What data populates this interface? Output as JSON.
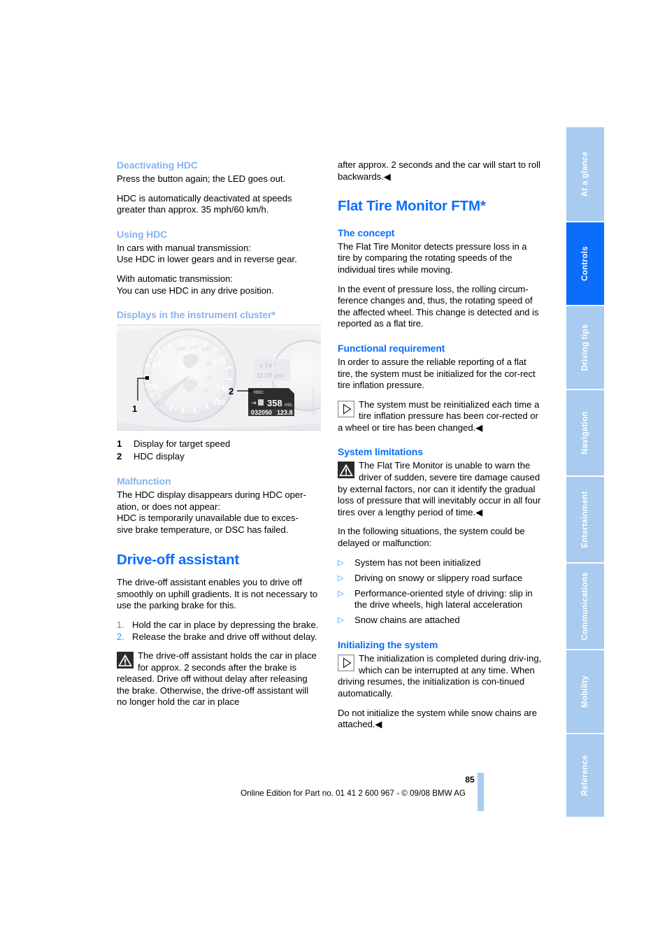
{
  "page": {
    "number": "85",
    "footer": "Online Edition for Part no. 01 41 2 600 967  - © 09/08 BMW AG"
  },
  "colors": {
    "heading_primary": "#0a6efa",
    "heading_secondary": "#85b4ed",
    "tab_inactive": "#a9cbef",
    "tab_active": "#0a6efa",
    "bullet": "#3d8ef5"
  },
  "sidebar": {
    "tabs": [
      {
        "label": "At a glance",
        "active": false
      },
      {
        "label": "Controls",
        "active": true
      },
      {
        "label": "Driving tips",
        "active": false
      },
      {
        "label": "Navigation",
        "active": false
      },
      {
        "label": "Entertainment",
        "active": false
      },
      {
        "label": "Communications",
        "active": false
      },
      {
        "label": "Mobility",
        "active": false
      },
      {
        "label": "Reference",
        "active": false
      }
    ]
  },
  "left_column": {
    "h_deactivating": "Deactivating HDC",
    "p_deactivating_1": "Press the button again; the LED goes out.",
    "p_deactivating_2": "HDC is automatically deactivated at speeds greater than approx. 35 mph/60 km/h.",
    "h_using": "Using HDC",
    "p_using_1": "In cars with manual transmission:\nUse HDC in lower gears and in reverse gear.",
    "p_using_2": "With automatic transmission:\nYou can use HDC in any drive position.",
    "h_displays": "Displays in the instrument cluster*",
    "figure": {
      "callout_1": "1",
      "callout_2": "2",
      "display_hdc_label": "HDC",
      "display_range": "358",
      "display_range_unit": "mls",
      "display_odometer": "032050",
      "display_trip": "123.8",
      "display_temp": "74",
      "display_clock": "11:15 pm",
      "speedo_ticks": [
        "20",
        "40",
        "100",
        "120",
        "140",
        "160"
      ],
      "speedo_inner_ticks": [
        "20",
        "40",
        "120",
        "140",
        "160"
      ],
      "legend": [
        {
          "num": "1",
          "text": "Display for target speed"
        },
        {
          "num": "2",
          "text": "HDC display"
        }
      ]
    },
    "h_malfunction": "Malfunction",
    "p_malfunction": "The HDC display disappears during HDC oper-\nation, or does not appear:\nHDC is temporarily unavailable due to exces-\nsive brake temperature, or DSC has failed.",
    "h_driveoff": "Drive-off assistant",
    "p_driveoff_intro": "The drive-off assistant enables you to drive off smoothly on uphill gradients. It is not necessary to use the parking brake for this.",
    "steps": [
      {
        "num": "1.",
        "text": "Hold the car in place by depressing the brake."
      },
      {
        "num": "2.",
        "text": "Release the brake and drive off without delay."
      }
    ],
    "warning_driveoff": "The drive-off assistant holds the car in place for approx. 2 seconds after the brake is released. Drive off without delay after releasing the brake. Otherwise, the drive-off assistant will no longer hold the car in place"
  },
  "right_column": {
    "p_continuation": "after approx. 2 seconds and the car will start to roll backwards.◀",
    "h_ftm": "Flat Tire Monitor FTM*",
    "h_concept": "The concept",
    "p_concept_1": "The Flat Tire Monitor detects pressure loss in a tire by comparing the rotating speeds of the individual tires while moving.",
    "p_concept_2": "In the event of pressure loss, the rolling circum-ference changes and, thus, the rotating speed of the affected wheel. This change is detected and is reported as a flat tire.",
    "h_functional": "Functional requirement",
    "p_functional": "In order to assure the reliable reporting of a flat tire, the system must be initialized for the cor-rect tire inflation pressure.",
    "note_functional": "The system must be reinitialized each time a tire inflation pressure has been cor-rected or a wheel or tire has been changed.◀",
    "h_limitations": "System limitations",
    "warning_limitations": "The Flat Tire Monitor is unable to warn the driver of sudden, severe tire damage caused by external factors, nor can it identify the gradual loss of pressure that will inevitably occur in all four tires over a lengthy period of time.◀",
    "p_situations": "In the following situations, the system could be delayed or malfunction:",
    "bullets": [
      "System has not been initialized",
      "Driving on snowy or slippery road surface",
      "Performance-oriented style of driving: slip in the drive wheels, high lateral acceleration",
      "Snow chains are attached"
    ],
    "h_initializing": "Initializing the system",
    "note_initializing": "The initialization is completed during driv-ing, which can be interrupted at any time. When driving resumes, the initialization is con-tinued automatically.",
    "p_initializing_extra": "Do not initialize the system while snow chains are attached.◀"
  }
}
